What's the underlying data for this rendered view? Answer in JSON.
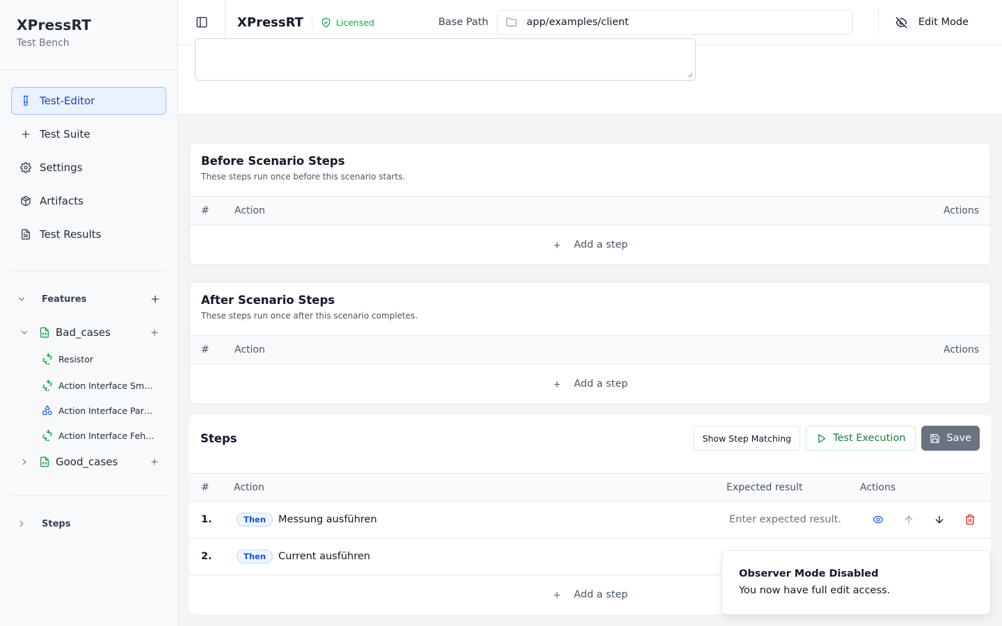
{
  "brand": {
    "title": "XPressRT",
    "subtitle": "Test Bench"
  },
  "nav": [
    {
      "label": "Test-Editor",
      "icon": "test-tube-icon",
      "active": true
    },
    {
      "label": "Test Suite",
      "icon": "plus-icon"
    },
    {
      "label": "Settings",
      "icon": "gear-icon"
    },
    {
      "label": "Artifacts",
      "icon": "package-icon"
    },
    {
      "label": "Test Results",
      "icon": "document-icon"
    }
  ],
  "features": {
    "label": "Features",
    "folders": [
      {
        "name": "Bad_cases",
        "expanded": true,
        "items": [
          {
            "label": "Resistor",
            "icon": "puzzle-icon"
          },
          {
            "label": "Action Interface Smo...",
            "icon": "puzzle-icon"
          },
          {
            "label": "Action Interface Para...",
            "icon": "shapes-icon"
          },
          {
            "label": "Action Interface Fehl...",
            "icon": "puzzle-icon"
          }
        ]
      },
      {
        "name": "Good_cases",
        "expanded": false
      }
    ]
  },
  "steps_section": {
    "label": "Steps"
  },
  "topbar": {
    "title": "XPressRT",
    "license": "Licensed",
    "base_path_label": "Base Path",
    "base_path_value": "app/examples/client",
    "edit_mode": "Edit Mode"
  },
  "before": {
    "title": "Before Scenario Steps",
    "subtitle": "These steps run once before this scenario starts.",
    "col_num": "#",
    "col_action": "Action",
    "col_actions": "Actions",
    "add": "Add a step"
  },
  "after": {
    "title": "After Scenario Steps",
    "subtitle": "These steps run once after this scenario completes.",
    "col_num": "#",
    "col_action": "Action",
    "col_actions": "Actions",
    "add": "Add a step"
  },
  "steps": {
    "title": "Steps",
    "show_matching": "Show Step Matching",
    "test_execution": "Test Execution",
    "save": "Save",
    "col_num": "#",
    "col_action": "Action",
    "col_expected": "Expected result",
    "col_actions": "Actions",
    "rows": [
      {
        "num": "1.",
        "keyword": "Then",
        "text": "Messung ausführen",
        "expected": "Enter expected result."
      },
      {
        "num": "2.",
        "keyword": "Then",
        "text": "Current ausführen",
        "expected": ""
      }
    ],
    "add": "Add a step"
  },
  "toast": {
    "title": "Observer Mode Disabled",
    "message": "You now have full edit access."
  },
  "colors": {
    "accent": "#2563eb",
    "success": "#16a34a",
    "danger": "#dc2626"
  }
}
